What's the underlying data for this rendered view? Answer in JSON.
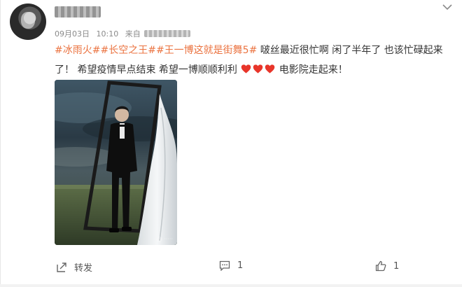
{
  "post": {
    "username": "",
    "date": "09月03日",
    "time": "10:10",
    "source_label": "来自",
    "tags": [
      "#冰雨火#",
      "#长空之王#",
      "#王一博这就是街舞5#"
    ],
    "text_line1": " 啵丝最近很忙啊 闲了半年了 也该忙碌起来",
    "text_line2": "了！ 希望疫情早点结束 希望一博顺顺利利 ",
    "text_end": " 电影院走起来！",
    "heart_color": "#e8352a",
    "tag_color": "#eb7340"
  },
  "actions": {
    "repost_label": "转发",
    "comment_count": "1",
    "like_count": "1"
  },
  "icons": {
    "menu": "chevron-down-icon",
    "repost": "repost-icon",
    "comment": "comment-icon",
    "like": "thumbs-up-icon"
  }
}
